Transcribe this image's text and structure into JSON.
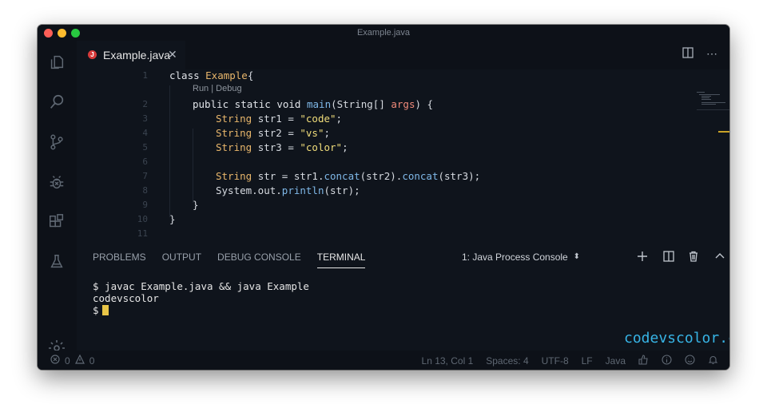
{
  "window": {
    "title": "Example.java"
  },
  "tab": {
    "badge": "J",
    "label": "Example.java",
    "close": "✕"
  },
  "code": {
    "line_numbers": [
      "1",
      "2",
      "3",
      "4",
      "5",
      "6",
      "7",
      "8",
      "9",
      "10",
      "11"
    ],
    "lens": "Run | Debug",
    "lines": {
      "l1_kw": "class ",
      "l1_ty": "Example",
      "l1_p": "{",
      "l2_kw": "public static void ",
      "l2_fn": "main",
      "l2_a": "(String[] ",
      "l2_pm": "args",
      "l2_b": ") {",
      "l3_ty": "String ",
      "l3_a": "str1 = ",
      "l3_st": "\"code\"",
      "l3_b": ";",
      "l4_ty": "String ",
      "l4_a": "str2 = ",
      "l4_st": "\"vs\"",
      "l4_b": ";",
      "l5_ty": "String ",
      "l5_a": "str3 = ",
      "l5_st": "\"color\"",
      "l5_b": ";",
      "l7_ty": "String ",
      "l7_a": "str = str1.",
      "l7_fn1": "concat",
      "l7_b": "(str2).",
      "l7_fn2": "concat",
      "l7_c": "(str3);",
      "l8_a": "System.out.",
      "l8_fn": "println",
      "l8_b": "(str);",
      "l9": "}",
      "l10": "}"
    }
  },
  "panel": {
    "tabs": [
      "PROBLEMS",
      "OUTPUT",
      "DEBUG CONSOLE",
      "TERMINAL"
    ],
    "active_tab": "TERMINAL",
    "terminal_select": "1: Java Process Console",
    "terminal_lines": [
      "$ javac Example.java && java Example",
      "codevscolor",
      "$"
    ],
    "watermark": "codevscolor.com"
  },
  "status": {
    "errors": "0",
    "warnings": "0",
    "position": "Ln 13, Col 1",
    "spaces": "Spaces: 4",
    "encoding": "UTF-8",
    "eol": "LF",
    "language": "Java"
  },
  "colors": {
    "accent": "#3a7bd5",
    "cursor": "#e8c547",
    "watermark": "#37b4e6"
  }
}
